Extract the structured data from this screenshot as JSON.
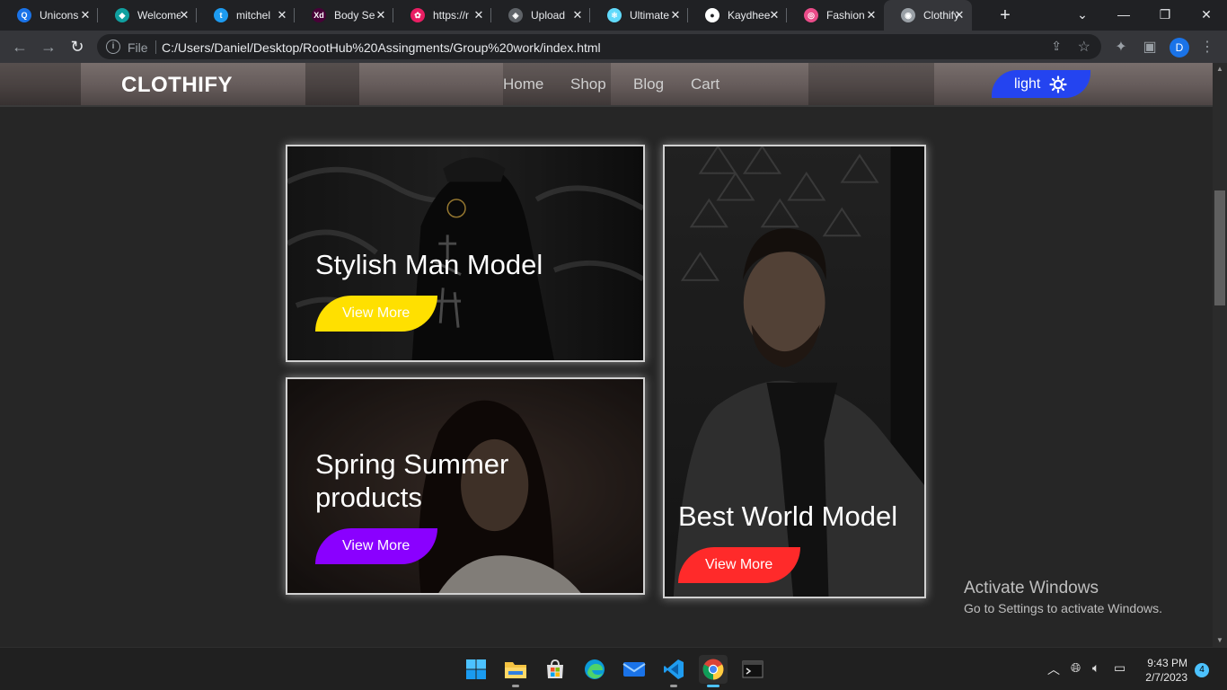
{
  "browser": {
    "tabs": [
      {
        "title": "Unicons",
        "favicon_color": "#1a73e8",
        "favicon_glyph": "Q",
        "icon": "search-icon"
      },
      {
        "title": "Welcome",
        "favicon_color": "#10a0a0",
        "favicon_glyph": "◆",
        "icon": "diamond-icon"
      },
      {
        "title": "mitchel",
        "favicon_color": "#1d9bf0",
        "favicon_glyph": "t",
        "icon": "twitter-icon"
      },
      {
        "title": "Body Se",
        "favicon_color": "#470137",
        "favicon_glyph": "Xd",
        "icon": "adobe-xd-icon"
      },
      {
        "title": "https://r",
        "favicon_color": "#e91e63",
        "favicon_glyph": "✿",
        "icon": "dribbble-like-icon"
      },
      {
        "title": "Upload",
        "favicon_color": "#5f6368",
        "favicon_glyph": "◈",
        "icon": "layers-icon"
      },
      {
        "title": "Ultimate",
        "favicon_color": "#61dafb",
        "favicon_glyph": "⚛",
        "icon": "react-icon"
      },
      {
        "title": "Kaydhee",
        "favicon_color": "#ffffff",
        "favicon_glyph": "●",
        "icon": "github-icon"
      },
      {
        "title": "Fashion",
        "favicon_color": "#ea4c89",
        "favicon_glyph": "◎",
        "icon": "dribbble-icon"
      },
      {
        "title": "Clothify",
        "favicon_color": "#9aa0a6",
        "favicon_glyph": "◉",
        "icon": "globe-icon",
        "active": true
      }
    ],
    "address": {
      "scheme_label": "File",
      "url": "C:/Users/Daniel/Desktop/RootHub%20Assingments/Group%20work/index.html"
    },
    "profile_initial": "D"
  },
  "site": {
    "logo": "CLOTHIFY",
    "nav": [
      "Home",
      "Shop",
      "Blog",
      "Cart"
    ],
    "mode_toggle_label": "light",
    "cards": [
      {
        "title": "Stylish Man Model",
        "button": "View More",
        "button_color": "#ffe000"
      },
      {
        "title": "Spring Summer products",
        "title_line1": "Spring Summer",
        "title_line2": "products",
        "button": "View More",
        "button_color": "#8a00ff"
      },
      {
        "title": "Best World Model",
        "button": "View More",
        "button_color": "#ff2a2a"
      }
    ],
    "accent_color": "#2444f0"
  },
  "watermark": {
    "title": "Activate Windows",
    "subtitle": "Go to Settings to activate Windows."
  },
  "taskbar": {
    "apps": [
      "start-icon",
      "file-explorer-icon",
      "store-icon",
      "edge-icon",
      "mail-icon",
      "vscode-icon",
      "chrome-icon",
      "terminal-icon"
    ],
    "time": "9:43 PM",
    "date": "2/7/2023",
    "notification_count": "4"
  }
}
